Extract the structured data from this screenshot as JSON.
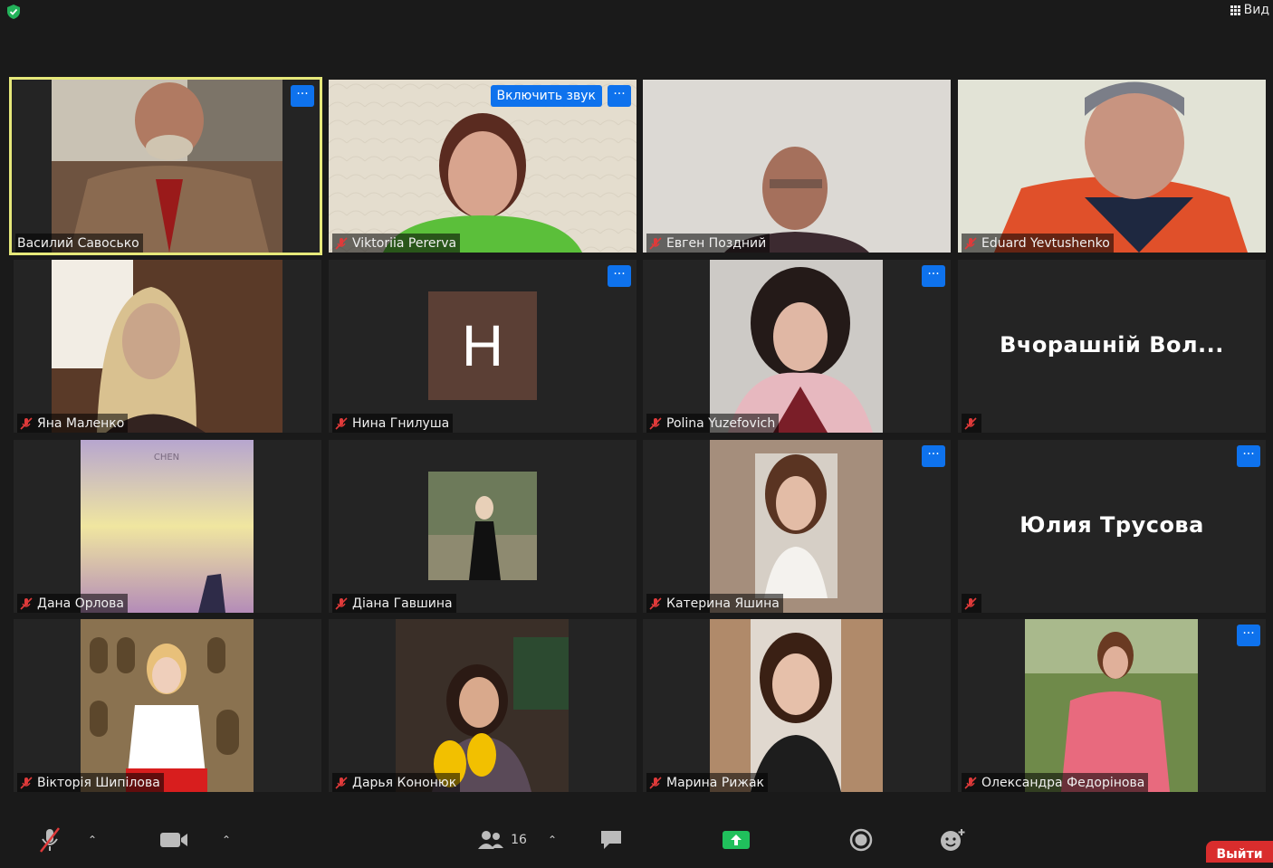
{
  "topbar": {
    "view_label": "Вид"
  },
  "tiles": [
    {
      "name": "Василий Савосько",
      "muted": false,
      "more": true
    },
    {
      "name": "Viktoriia Pererva",
      "muted": true,
      "more": true,
      "unmute_label": "Включить звук"
    },
    {
      "name": "Евген Поздний",
      "muted": true,
      "more": false
    },
    {
      "name": "Eduard Yevtushenko",
      "muted": true,
      "more": false
    },
    {
      "name": "Яна Маленко",
      "muted": true,
      "more": false
    },
    {
      "name": "Нина Гнилуша",
      "muted": true,
      "more": true,
      "avatar_letter": "H"
    },
    {
      "name": "Polina Yuzefovich",
      "muted": true,
      "more": true
    },
    {
      "name": "",
      "muted": true,
      "more": false,
      "display_name": "Вчорашній Вол..."
    },
    {
      "name": "Дана Орлова",
      "muted": true,
      "more": false,
      "cover_text": "CHEN"
    },
    {
      "name": "Діана Гавшина",
      "muted": true,
      "more": false
    },
    {
      "name": "Катерина Яшина",
      "muted": true,
      "more": true
    },
    {
      "name": "",
      "muted": true,
      "more": true,
      "display_name": "Юлия Трусова"
    },
    {
      "name": "Вікторія Шипілова",
      "muted": true,
      "more": false
    },
    {
      "name": "Дарья Кононюк",
      "muted": true,
      "more": false
    },
    {
      "name": "Марина Рижак",
      "muted": true,
      "more": false
    },
    {
      "name": "Олександра Федорінова",
      "muted": true,
      "more": true
    }
  ],
  "more_label": "···",
  "toolbar": {
    "participants_count": "16",
    "leave_label": "Выйти"
  },
  "colors": {
    "accent": "#0e72ed",
    "active_speaker": "#e6e87a",
    "leave": "#d92d2d",
    "share": "#20c05c"
  }
}
